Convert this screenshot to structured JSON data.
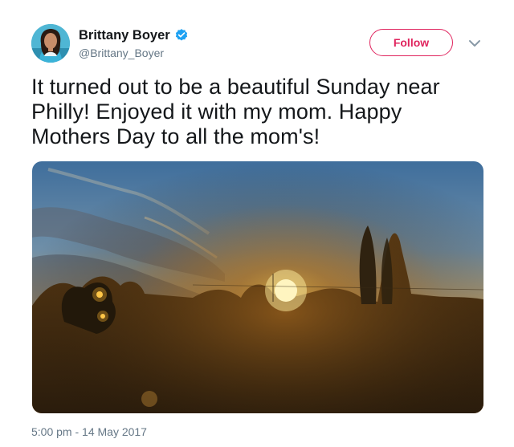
{
  "tweet": {
    "author": {
      "display_name": "Brittany Boyer",
      "handle": "@Brittany_Boyer",
      "verified": true,
      "avatar_icon": "profile-photo"
    },
    "follow_label": "Follow",
    "more_icon": "chevron-down-icon",
    "text": "It turned out to be a beautiful Sunday near Philly! Enjoyed it with my mom. Happy Mothers Day to all the mom's!",
    "photo_icon": "sunset-photo",
    "timestamp": "5:00 pm - 14 May 2017"
  },
  "colors": {
    "accent": "#e0245e",
    "verified": "#1da1f2",
    "secondary_text": "#657786",
    "primary_text": "#14171a"
  }
}
